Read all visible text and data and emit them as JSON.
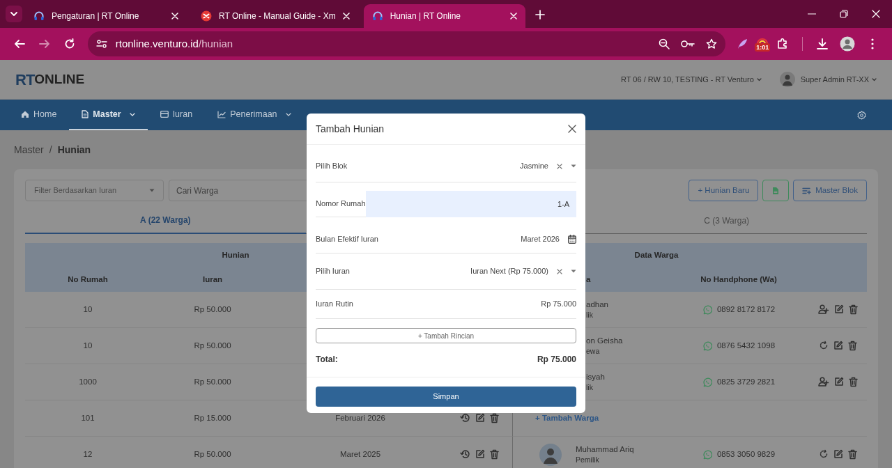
{
  "browser": {
    "tabs": [
      {
        "title": "Pengaturan | RT Online",
        "kind": "headset",
        "selected": false
      },
      {
        "title": "RT Online - Manual Guide - Xm",
        "kind": "guide",
        "selected": false
      },
      {
        "title": "Hunian | RT Online",
        "kind": "headset",
        "selected": true
      }
    ],
    "nav_buttons": [
      {
        "kind": "back",
        "disabled": false
      },
      {
        "kind": "forward",
        "disabled": true
      },
      {
        "kind": "reload",
        "disabled": false
      }
    ],
    "address": {
      "host": "rtonline.venturo.id",
      "path": "/hunian"
    },
    "extension_badge": "1:01"
  },
  "header": {
    "logo": {
      "main": "RT",
      "rest": "ONLINE"
    },
    "rt_selector": "RT 06 / RW 10, TESTING - RT Venturo",
    "user": "Super Admin RT-XX"
  },
  "nav": {
    "items": [
      {
        "label": "Home",
        "kind": "home",
        "dropdown": false,
        "selected": false
      },
      {
        "label": "Master",
        "kind": "document",
        "dropdown": true,
        "selected": true
      },
      {
        "label": "Iuran",
        "kind": "card",
        "dropdown": false,
        "selected": false
      },
      {
        "label": "Penerimaan",
        "kind": "chart",
        "dropdown": true,
        "selected": false
      }
    ]
  },
  "breadcrumb": {
    "separator": "/",
    "items": [
      {
        "label": "Master"
      },
      {
        "label": "Hunian"
      }
    ]
  },
  "filters": {
    "iuran_filter": {
      "placeholder": "Filter Berdasarkan Iuran"
    },
    "search": {
      "placeholder": "Cari Warga"
    }
  },
  "toolbar_buttons": [
    {
      "kind": "add",
      "label": "+ Hunian Baru"
    },
    {
      "kind": "export"
    },
    {
      "kind": "list",
      "label": "Master Blok"
    }
  ],
  "block_tabs": [
    {
      "label": "A (22 Warga)",
      "selected": true
    },
    {
      "label": "C (3 Warga)",
      "selected": false
    }
  ],
  "table": {
    "groups": [
      "Hunian",
      "Data Warga"
    ],
    "columns": {
      "no_rumah": "No Rumah",
      "iuran": "Iuran",
      "column_5": "a",
      "phone": "No Handphone (Wa)"
    },
    "rows": [
      {
        "no_rumah": "10",
        "iuran": "Rp 50.000",
        "warga": {
          "kind": "covered",
          "name": "adhan",
          "role": "lik"
        },
        "phone": "0892 8172 8172",
        "actions": [
          {
            "kind": "add-user"
          },
          {
            "kind": "edit"
          },
          {
            "kind": "delete"
          }
        ]
      },
      {
        "no_rumah": "10",
        "iuran": "Rp 50.000",
        "warga": {
          "kind": "covered",
          "name": "on Geisha",
          "role": "ewa"
        },
        "phone": "0876 5432 1098",
        "actions": [
          {
            "kind": "reset"
          },
          {
            "kind": "edit"
          },
          {
            "kind": "delete"
          }
        ]
      },
      {
        "no_rumah": "1000",
        "iuran": "Rp 50.000",
        "warga": {
          "kind": "covered",
          "name": "isyah",
          "role": "lik"
        },
        "phone": "0825 3729 2821",
        "actions": [
          {
            "kind": "add-user"
          },
          {
            "kind": "edit"
          },
          {
            "kind": "delete"
          }
        ]
      },
      {
        "no_rumah": "101",
        "iuran": "Rp 15.000",
        "bulan": "Februari 2026",
        "hunian_actions": [
          {
            "kind": "history"
          },
          {
            "kind": "edit"
          },
          {
            "kind": "delete"
          }
        ],
        "warga": {
          "kind": "add",
          "label": "+ Tambah Warga"
        }
      },
      {
        "no_rumah": "12",
        "iuran": "Rp 50.000",
        "bulan": "Maret 2025",
        "hunian_actions": [
          {
            "kind": "history"
          },
          {
            "kind": "edit"
          },
          {
            "kind": "delete"
          }
        ],
        "warga": {
          "kind": "member",
          "name": "Muhammad Ariq",
          "role": "Pemilik"
        },
        "phone": "0853 3050 9829",
        "actions": [
          {
            "kind": "reset"
          },
          {
            "kind": "edit"
          },
          {
            "kind": "delete"
          }
        ]
      }
    ]
  },
  "modal": {
    "title": "Tambah Hunian",
    "fields": [
      {
        "kind": "select",
        "label": "Pilih Blok",
        "value": "Jasmine"
      },
      {
        "kind": "input",
        "label": "Nomor Rumah",
        "value": "1-A"
      },
      {
        "kind": "month",
        "label": "Bulan Efektif Iuran",
        "value": "Maret 2026"
      },
      {
        "kind": "select",
        "label": "Pilih Iuran",
        "value": "Iuran Next (Rp 75.000)"
      },
      {
        "kind": "static",
        "label": "Iuran Rutin",
        "value": "Rp 75.000"
      }
    ],
    "add_detail": "+ Tambah Rincian",
    "total_label": "Total:",
    "total": "Rp 75.000",
    "submit": "Simpan"
  }
}
